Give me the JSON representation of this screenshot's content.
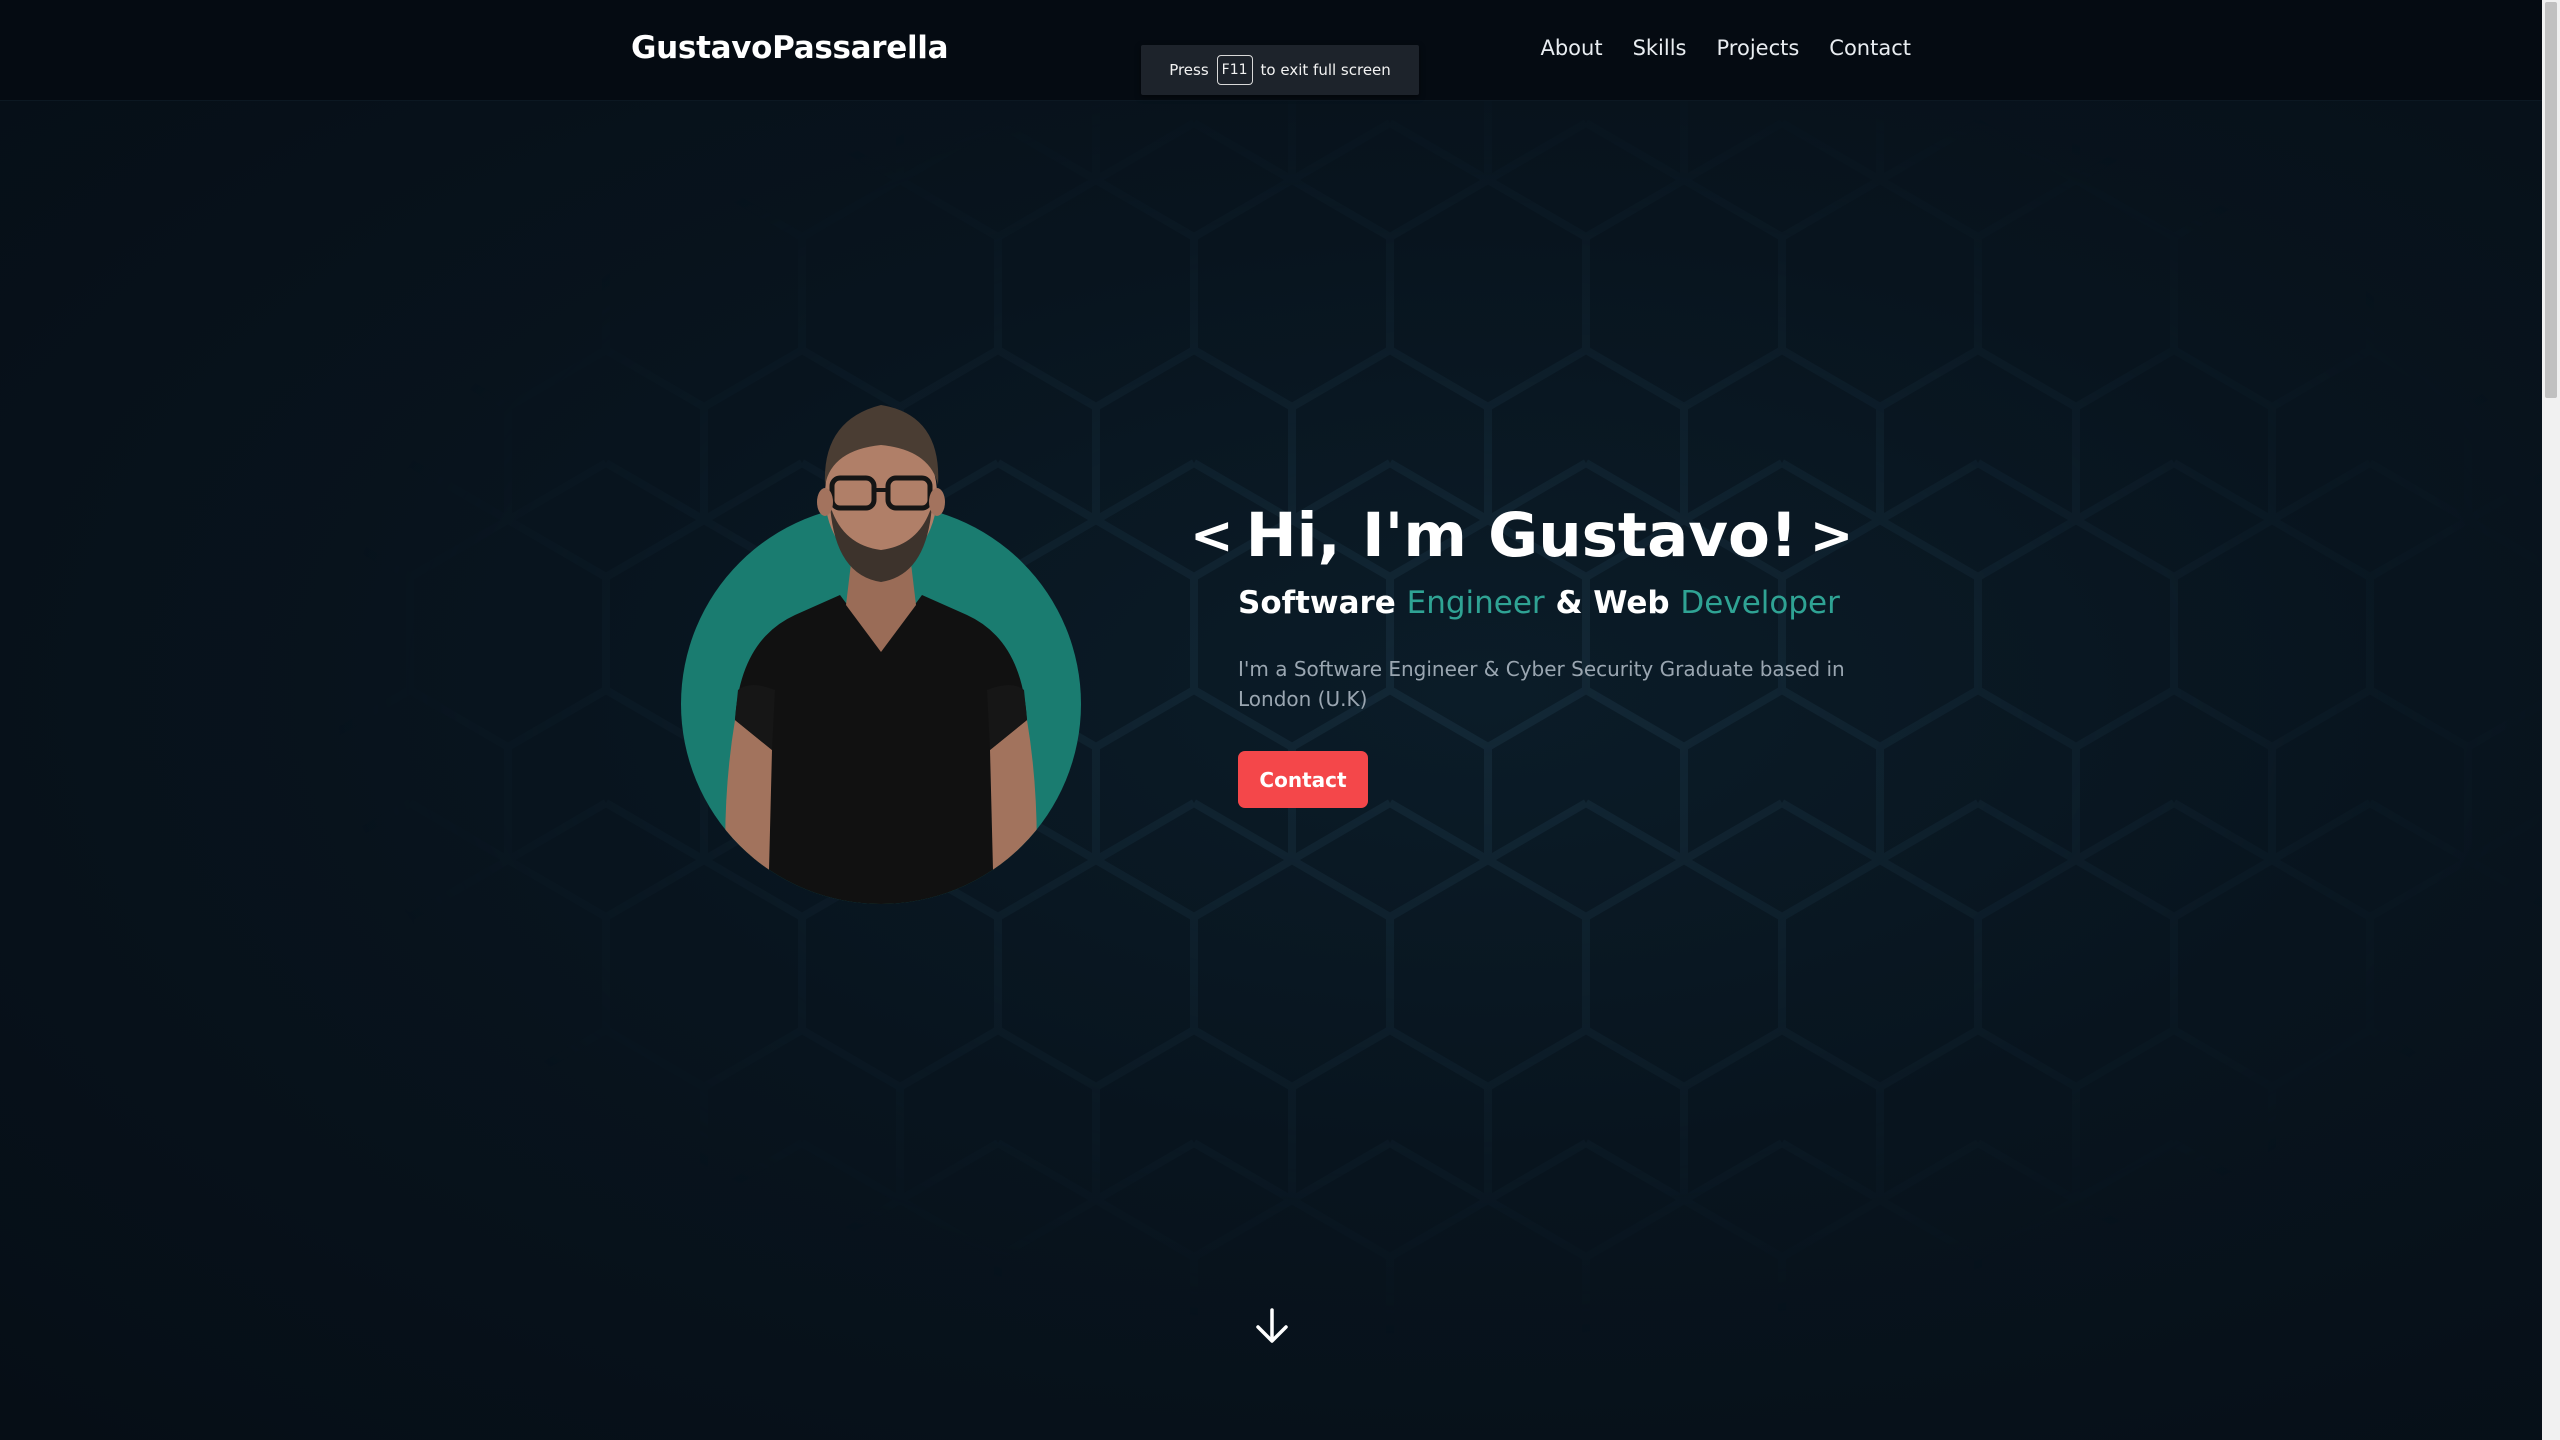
{
  "navbar": {
    "brand": "GustavoPassarella",
    "links": [
      "About",
      "Skills",
      "Projects",
      "Contact"
    ]
  },
  "fullscreen_hint": {
    "prefix": "Press",
    "key": "F11",
    "suffix": "to exit full screen"
  },
  "hero": {
    "bracket_open": "<",
    "title": "Hi, I'm Gustavo!",
    "bracket_close": ">",
    "subtitle_parts": {
      "p1": "Software",
      "p2": "Engineer",
      "p3": "& Web",
      "p4": "Developer"
    },
    "description": "I'm a Software Engineer & Cyber Security Graduate based in London (U.K)",
    "contact_label": "Contact"
  },
  "colors": {
    "accent": "#2fa394",
    "button": "#f4474a",
    "portrait_circle": "#1a7c70",
    "background": "#07121b"
  },
  "icons": {
    "scroll": "arrow-down-icon",
    "portrait": "profile-photo"
  }
}
